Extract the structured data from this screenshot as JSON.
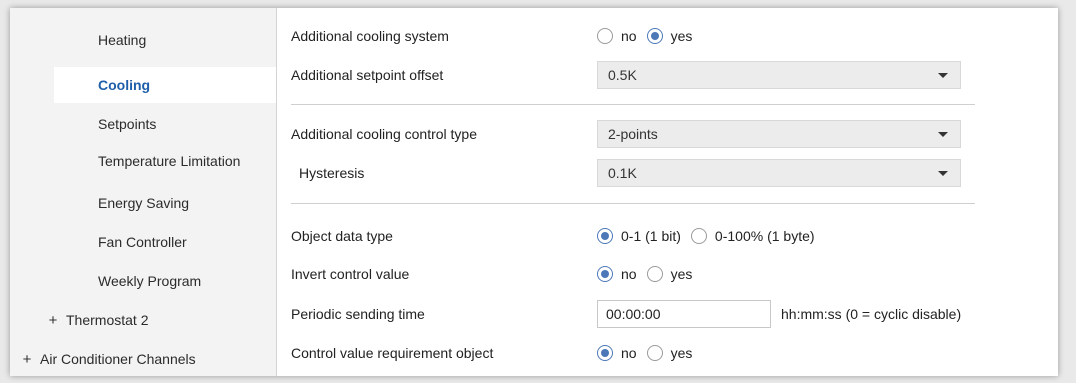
{
  "sidebar": {
    "items": [
      {
        "label": "Heating"
      },
      {
        "label": "Cooling"
      },
      {
        "label": "Setpoints"
      },
      {
        "label": "Temperature Limitation"
      },
      {
        "label": "Energy Saving"
      },
      {
        "label": "Fan Controller"
      },
      {
        "label": "Weekly Program"
      }
    ],
    "groups": [
      {
        "expander": "+",
        "label": "Thermostat 2"
      },
      {
        "expander": "+",
        "label": "Air Conditioner Channels"
      }
    ]
  },
  "main": {
    "additional_cooling_system": {
      "label": "Additional cooling system",
      "options": [
        "no",
        "yes"
      ],
      "selected": "yes"
    },
    "additional_setpoint_offset": {
      "label": "Additional setpoint offset",
      "value": "0.5K"
    },
    "control_type": {
      "label": "Additional cooling control type",
      "value": "2-points"
    },
    "hysteresis": {
      "label": "Hysteresis",
      "value": "0.1K"
    },
    "object_data_type": {
      "label": "Object data type",
      "options": [
        "0-1 (1 bit)",
        "0-100% (1 byte)"
      ],
      "selected": "0-1 (1 bit)"
    },
    "invert_control_value": {
      "label": "Invert control value",
      "options": [
        "no",
        "yes"
      ],
      "selected": "no"
    },
    "periodic_sending_time": {
      "label": "Periodic sending time",
      "value": "00:00:00",
      "suffix": "hh:mm:ss (0 = cyclic disable)"
    },
    "control_value_requirement": {
      "label": "Control value requirement object",
      "options": [
        "no",
        "yes"
      ],
      "selected": "no"
    }
  },
  "colors": {
    "accent": "#1f5faa",
    "radio_selected": "#4c78b8",
    "sidebar_bg": "#f3f3f3"
  }
}
